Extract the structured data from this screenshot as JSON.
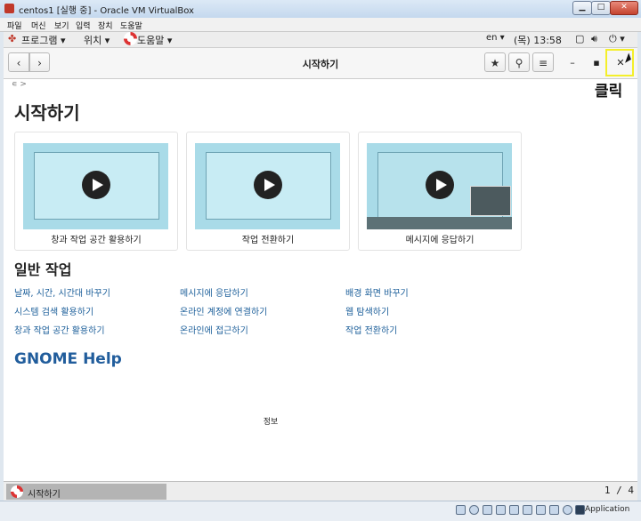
{
  "vbox": {
    "title": "centos1 [실행 중] - Oracle VM VirtualBox",
    "menu": [
      "파일",
      "머신",
      "보기",
      "입력",
      "장치",
      "도움말"
    ],
    "host_key": "Application"
  },
  "topbar": {
    "programs": "프로그램 ▾",
    "places": "위치 ▾",
    "app_menu": "도움말 ▾",
    "input_method": "en ▾",
    "clock": "(목) 13:58"
  },
  "headerbar": {
    "title": "시작하기"
  },
  "annotation": "클릭",
  "breadcrumb": "∊ >",
  "page": {
    "title": "시작하기",
    "videos": [
      {
        "label": "창과 작업 공간 활용하기"
      },
      {
        "label": "작업 전환하기"
      },
      {
        "label": "메시지에 응답하기"
      }
    ],
    "section_title": "일반 작업",
    "tasks": [
      [
        "날짜, 시간, 시간대 바꾸기",
        "메시지에 응답하기",
        "배경 화면 바꾸기"
      ],
      [
        "시스템 검색 활용하기",
        "온라인 계정에 연결하기",
        "웹 탐색하기"
      ],
      [
        "창과 작업 공간 활용하기",
        "온라인에 접근하기",
        "작업 전환하기"
      ]
    ],
    "gnome_help": "GNOME Help",
    "info": "정보"
  },
  "bottom_panel": {
    "task": "시작하기",
    "workspace": "1 / 4"
  }
}
